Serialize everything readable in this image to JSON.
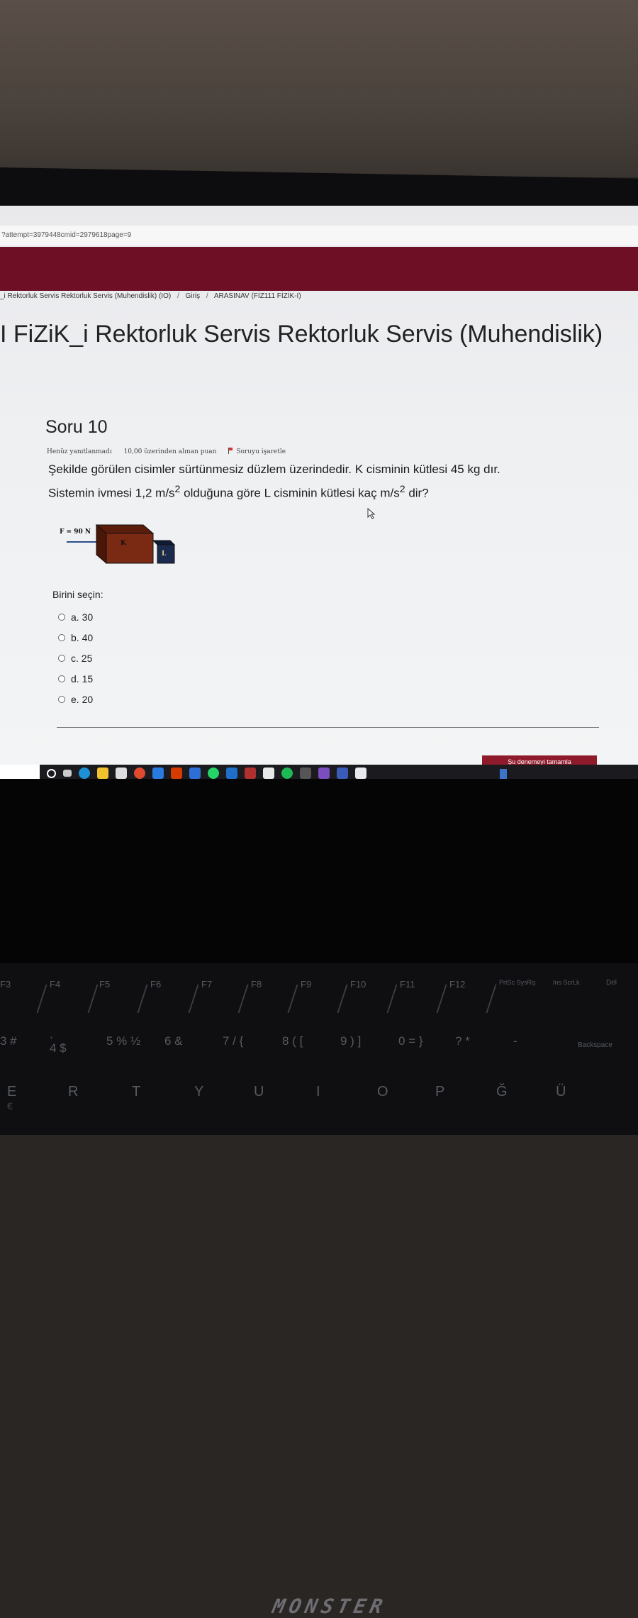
{
  "browser": {
    "url": "?attempt=3979448cmid=2979618page=9"
  },
  "breadcrumb": {
    "items": [
      "_i Rektorluk Servis Rektorluk Servis (Muhendislik) (IO)",
      "Giriş",
      "ARASINAV (FİZ111 FİZİK-I)"
    ],
    "separator": "/"
  },
  "course": {
    "title": "I FiZiK_i Rektorluk Servis Rektorluk Servis (Muhendislik)"
  },
  "question": {
    "title": "Soru 10",
    "status": "Henüz yanıtlanmadı",
    "points": "10,00 üzerinden alınan puan",
    "flag_label": "Soruyu işaretle",
    "text_line1": "Şekilde görülen cisimler sürtünmesiz düzlem üzerindedir. K cisminin kütlesi 45 kg dır.",
    "text_line2_a": "Sistemin ivmesi 1,2 m/s",
    "text_line2_sup1": "2",
    "text_line2_b": " olduğuna göre L cisminin kütlesi kaç m/s",
    "text_line2_sup2": "2",
    "text_line2_c": " dir?"
  },
  "figure": {
    "force_label": "F = 90 N",
    "block_k": "K",
    "block_l": "L"
  },
  "choices": {
    "prompt": "Birini seçin:",
    "options": [
      "a. 30",
      "b. 40",
      "c. 25",
      "d. 15",
      "e. 20"
    ]
  },
  "footer": {
    "finish_button": "Şu denemeyi tamamla"
  },
  "laptop": {
    "brand": "MONSTER"
  },
  "keyboard": {
    "fn_row": [
      "F3",
      "F4",
      "F5",
      "F6",
      "F7",
      "F8",
      "F9",
      "F10",
      "F11",
      "F12",
      "PrtSc SysRq",
      "Ins ScrLk",
      "Del"
    ],
    "num_row": [
      "3 #",
      "4 $",
      "5 %",
      "6 &",
      "7 /",
      "8 (",
      "9 )",
      "0 =",
      "?",
      "-",
      "Backspace"
    ],
    "num_row_sub": [
      "",
      "+",
      "½",
      "",
      "{",
      "[",
      "]",
      "}",
      "*",
      "",
      ""
    ],
    "letter_row": [
      "E",
      "R",
      "T",
      "Y",
      "U",
      "I",
      "O",
      "P",
      "Ğ",
      "Ü"
    ],
    "letter_sub": [
      "€"
    ]
  },
  "colors": {
    "accent": "#6e0f25",
    "button": "#8e1a2c",
    "block_k": "#7a2a12",
    "block_l": "#1b2b4d"
  }
}
